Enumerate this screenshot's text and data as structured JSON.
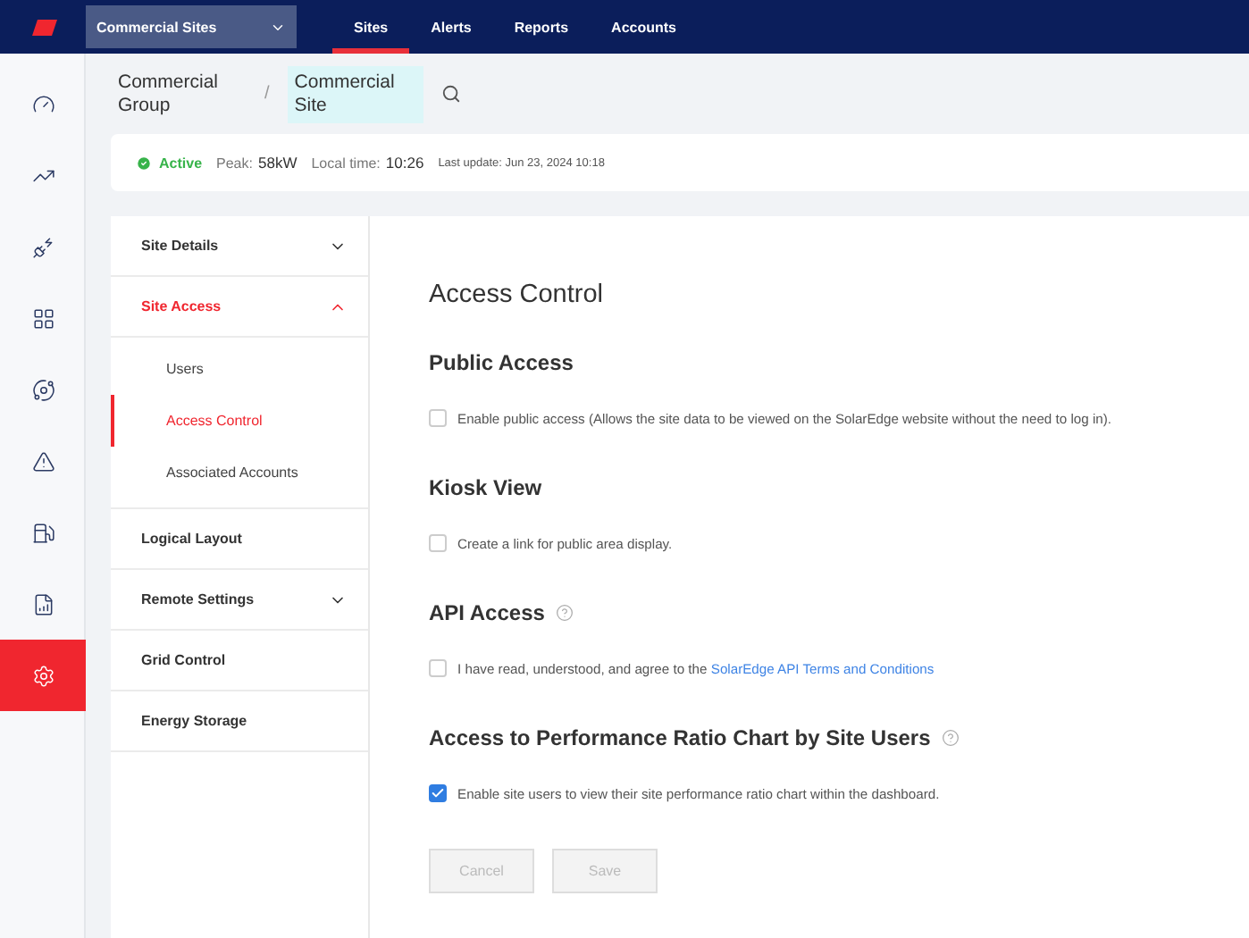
{
  "top_bar": {
    "site_selector": "Commercial Sites",
    "tabs": [
      {
        "label": "Sites",
        "selected": true
      },
      {
        "label": "Alerts",
        "selected": false
      },
      {
        "label": "Reports",
        "selected": false
      },
      {
        "label": "Accounts",
        "selected": false
      }
    ]
  },
  "rail_items": [
    {
      "selected": false
    },
    {
      "selected": false
    },
    {
      "selected": false
    },
    {
      "selected": false
    },
    {
      "selected": false
    },
    {
      "selected": false
    },
    {
      "selected": false
    },
    {
      "selected": false
    },
    {
      "selected": true
    }
  ],
  "breadcrumb_separator": "/",
  "breadcrumb": [
    {
      "label": "Commercial Group",
      "selected": false
    },
    {
      "label": "Commercial Site",
      "selected": true
    }
  ],
  "status": {
    "state": "Active",
    "peak_label": "Peak:",
    "peak": "58kW",
    "time_label": "Local time:",
    "time": "10:26",
    "last_update": "Last update: Jun 23, 2024 10:18"
  },
  "settings_nav": [
    {
      "label": "Site Details",
      "selected": false,
      "expanded": false
    },
    {
      "label": "Site Access",
      "selected": true,
      "expanded": true,
      "children": [
        {
          "label": "Users",
          "selected": false
        },
        {
          "label": "Access Control",
          "selected": true
        },
        {
          "label": "Associated Accounts",
          "selected": false
        }
      ]
    },
    {
      "label": "Logical Layout",
      "selected": false
    },
    {
      "label": "Remote Settings",
      "selected": false,
      "expanded": false
    },
    {
      "label": "Grid Control",
      "selected": false
    },
    {
      "label": "Energy Storage",
      "selected": false
    }
  ],
  "page_title": "Access Control",
  "sections": [
    {
      "title": "Public Access",
      "help": false,
      "checked": false,
      "text": "Enable public access (Allows the site data to be viewed on the SolarEdge website without the need to log in)."
    },
    {
      "title": "Kiosk View",
      "help": false,
      "checked": false,
      "text": "Create a link for public area display."
    },
    {
      "title": "API Access",
      "help": true,
      "checked": false,
      "text": "I have read, understood, and agree to the",
      "link": "SolarEdge API Terms and Conditions"
    },
    {
      "title": "Access to Performance Ratio Chart by Site Users",
      "help": true,
      "checked": true,
      "text": "Enable site users to view their site performance ratio chart within the dashboard."
    }
  ],
  "buttons": [
    {
      "label": "Cancel",
      "disabled": true
    },
    {
      "label": "Save",
      "disabled": true
    }
  ]
}
